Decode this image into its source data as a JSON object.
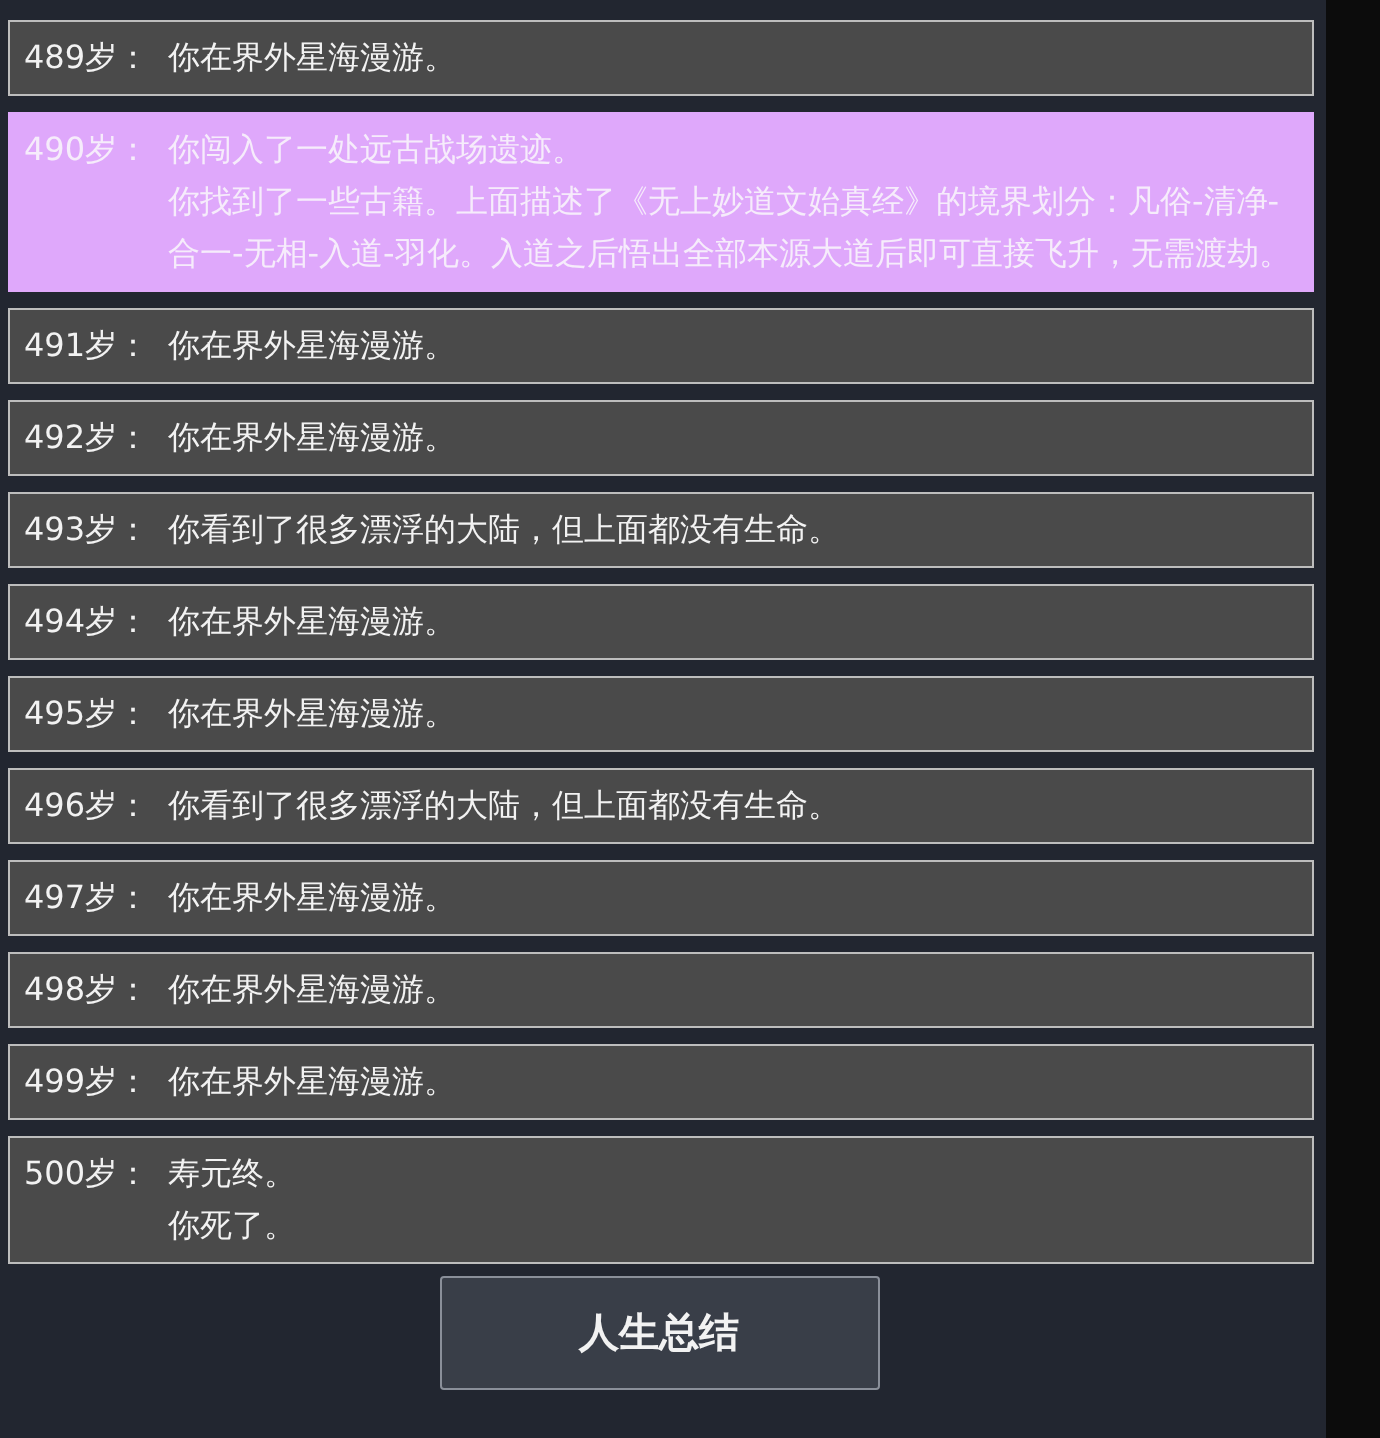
{
  "log": [
    {
      "age": "489岁：",
      "lines": [
        "你在界外星海漫游。"
      ],
      "highlighted": false
    },
    {
      "age": "490岁：",
      "lines": [
        "你闯入了一处远古战场遗迹。",
        "你找到了一些古籍。上面描述了《无上妙道文始真经》的境界划分：凡俗-清净-合一-无相-入道-羽化。入道之后悟出全部本源大道后即可直接飞升，无需渡劫。"
      ],
      "highlighted": true
    },
    {
      "age": "491岁：",
      "lines": [
        "你在界外星海漫游。"
      ],
      "highlighted": false
    },
    {
      "age": "492岁：",
      "lines": [
        "你在界外星海漫游。"
      ],
      "highlighted": false
    },
    {
      "age": "493岁：",
      "lines": [
        "你看到了很多漂浮的大陆，但上面都没有生命。"
      ],
      "highlighted": false
    },
    {
      "age": "494岁：",
      "lines": [
        "你在界外星海漫游。"
      ],
      "highlighted": false
    },
    {
      "age": "495岁：",
      "lines": [
        "你在界外星海漫游。"
      ],
      "highlighted": false
    },
    {
      "age": "496岁：",
      "lines": [
        "你看到了很多漂浮的大陆，但上面都没有生命。"
      ],
      "highlighted": false
    },
    {
      "age": "497岁：",
      "lines": [
        "你在界外星海漫游。"
      ],
      "highlighted": false
    },
    {
      "age": "498岁：",
      "lines": [
        "你在界外星海漫游。"
      ],
      "highlighted": false
    },
    {
      "age": "499岁：",
      "lines": [
        "你在界外星海漫游。"
      ],
      "highlighted": false
    },
    {
      "age": "500岁：",
      "lines": [
        "寿元终。",
        "你死了。"
      ],
      "highlighted": false
    }
  ],
  "summary_button": "人生总结"
}
